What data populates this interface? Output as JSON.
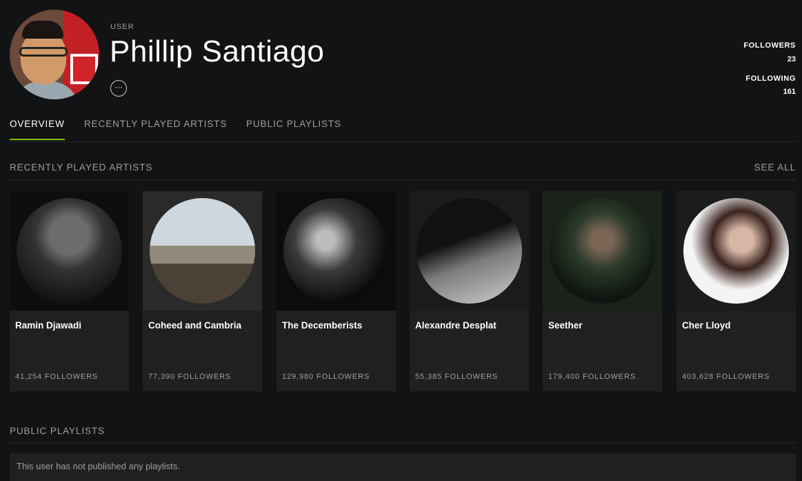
{
  "profile": {
    "kind": "USER",
    "name": "Phillip Santiago",
    "more": "···"
  },
  "stats": {
    "followers_label": "FOLLOWERS",
    "followers_value": "23",
    "following_label": "FOLLOWING",
    "following_value": "161"
  },
  "tabs": [
    {
      "label": "OVERVIEW",
      "active": true
    },
    {
      "label": "RECENTLY PLAYED ARTISTS",
      "active": false
    },
    {
      "label": "PUBLIC PLAYLISTS",
      "active": false
    }
  ],
  "recent": {
    "title": "RECENTLY PLAYED ARTISTS",
    "see_all": "SEE ALL",
    "artists": [
      {
        "name": "Ramin Djawadi",
        "followers": "41,254 FOLLOWERS"
      },
      {
        "name": "Coheed and Cambria",
        "followers": "77,390 FOLLOWERS"
      },
      {
        "name": "The Decemberists",
        "followers": "129,980 FOLLOWERS"
      },
      {
        "name": "Alexandre Desplat",
        "followers": "55,385 FOLLOWERS"
      },
      {
        "name": "Seether",
        "followers": "179,400 FOLLOWERS"
      },
      {
        "name": "Cher Lloyd",
        "followers": "403,628 FOLLOWERS"
      }
    ]
  },
  "playlists": {
    "title": "PUBLIC PLAYLISTS",
    "empty_message": "This user has not published any playlists."
  },
  "colors": {
    "background": "#121314",
    "card": "#1f2022",
    "accent": "#84bd00",
    "muted_text": "#a0a0a0"
  }
}
